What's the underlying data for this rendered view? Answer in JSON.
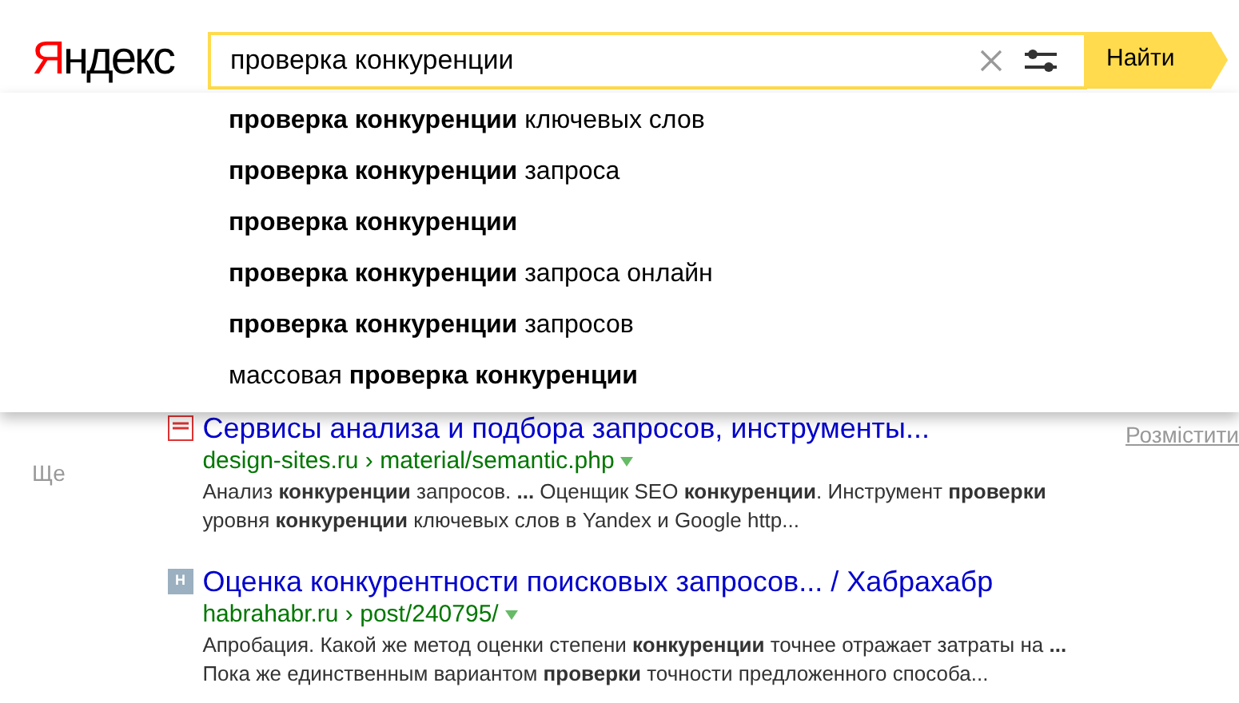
{
  "logo": {
    "first": "Я",
    "rest": "ндекс"
  },
  "search": {
    "value": "проверка конкуренции",
    "button": "Найти"
  },
  "suggestions": [
    "**проверка конкуренции** ключевых слов",
    "**проверка конкуренции** запроса",
    "**проверка конкуренции**",
    "**проверка конкуренции** запроса онлайн",
    "**проверка конкуренции** запросов",
    "массовая **проверка конкуренции**"
  ],
  "sidebar": {
    "more": "Ще"
  },
  "results": [
    {
      "kind": "site",
      "title": "Сервисы анализа и подбора запросов, инструменты...",
      "domain": "design-sites.ru",
      "sep": "›",
      "path": "material/semantic.php",
      "snippet": [
        "Анализ **конкуренции** запросов. **...** Оценщик SEO **конкуренции**. Инструмент **проверки**",
        "уровня **конкуренции** ключевых слов в Yandex и Google http..."
      ]
    },
    {
      "kind": "letter",
      "icon_text": "H",
      "title": "Оценка конкурентности поисковых запросов... / Хабрахабр",
      "domain": "habrahabr.ru",
      "sep": "›",
      "path": "post/240795/",
      "snippet": [
        "Апробация. Какой же метод оценки степени **конкуренции** точнее отражает затраты на **...**",
        "Пока же единственным вариантом **проверки** точности предложенного способа..."
      ]
    }
  ],
  "right": {
    "link": "Розмістити"
  }
}
